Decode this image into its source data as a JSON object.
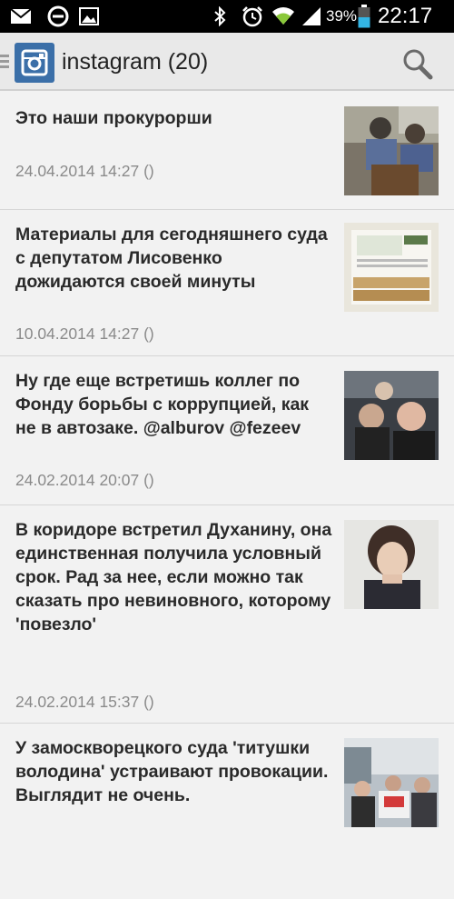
{
  "status_bar": {
    "battery_percent": "39%",
    "time": "22:17",
    "icons": [
      "mail-icon",
      "no-disturb-icon",
      "image-icon",
      "bluetooth-icon",
      "alarm-icon",
      "wifi-icon",
      "signal-icon",
      "battery-icon"
    ]
  },
  "action_bar": {
    "title": "instagram (20)",
    "app_icon": "instagram-icon",
    "search_icon": "search-icon"
  },
  "items": [
    {
      "title": "Это наши прокурорши",
      "date": "24.04.2014 14:27 ()"
    },
    {
      "title": "Материалы для сегодняшнего суда с депутатом Лисовенко дожидаются своей минуты",
      "date": "10.04.2014 14:27 ()"
    },
    {
      "title": "Ну где еще встретишь коллег по Фонду борьбы с коррупцией, как не в автозаке. @alburov @fezeev",
      "date": "24.02.2014 20:07 ()"
    },
    {
      "title": "В коридоре встретил Духанину, она единственная получила условный срок. Рад за нее, если можно так сказать про невиновного, которому 'повезло'",
      "date": "24.02.2014 15:37 ()"
    },
    {
      "title": "У замоскворецкого суда 'титушки володина' устраивают провокации. Выглядит не очень.",
      "date": ""
    }
  ],
  "colors": {
    "status_bar_bg": "#000000",
    "action_bar_bg": "#e9e9e9",
    "list_bg": "#f2f2f2",
    "title_text": "#2a2a2a",
    "date_text": "#8a8a8a",
    "battery_fill": "#33b5e5"
  }
}
